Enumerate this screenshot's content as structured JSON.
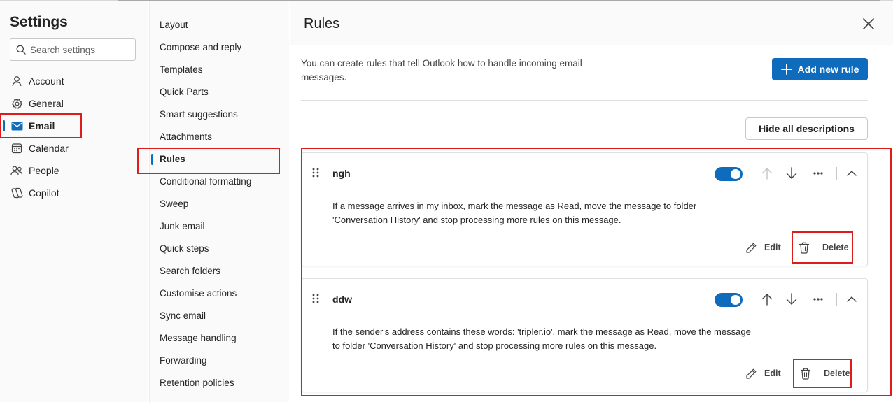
{
  "settings": {
    "title": "Settings",
    "search_placeholder": "Search settings"
  },
  "nav": {
    "items": [
      {
        "label": "Account",
        "icon": "person-icon"
      },
      {
        "label": "General",
        "icon": "gear-icon"
      },
      {
        "label": "Email",
        "icon": "mail-icon",
        "active": true
      },
      {
        "label": "Calendar",
        "icon": "calendar-icon"
      },
      {
        "label": "People",
        "icon": "people-icon"
      },
      {
        "label": "Copilot",
        "icon": "copilot-icon"
      }
    ]
  },
  "email_menu": {
    "items": [
      "Layout",
      "Compose and reply",
      "Templates",
      "Quick Parts",
      "Smart suggestions",
      "Attachments",
      "Rules",
      "Conditional formatting",
      "Sweep",
      "Junk email",
      "Quick steps",
      "Search folders",
      "Customise actions",
      "Sync email",
      "Message handling",
      "Forwarding",
      "Retention policies"
    ],
    "active": "Rules"
  },
  "main": {
    "title": "Rules",
    "intro": "You can create rules that tell Outlook how to handle incoming email messages.",
    "add_rule_label": "Add new rule",
    "hide_descriptions_label": "Hide all descriptions",
    "rules": [
      {
        "name": "ngh",
        "enabled": true,
        "description": "If a message arrives in my inbox, mark the message as Read, move the message to folder 'Conversation History' and stop processing more rules on this message.",
        "edit_label": "Edit",
        "delete_label": "Delete"
      },
      {
        "name": "ddw",
        "enabled": true,
        "description": "If the sender's address contains these words: 'tripler.io', mark the message as Read, move the message to folder 'Conversation History' and stop processing more rules on this message.",
        "edit_label": "Edit",
        "delete_label": "Delete"
      }
    ]
  },
  "colors": {
    "accent": "#0f6cbd",
    "highlight": "#e01b1b",
    "text": "#242424"
  }
}
